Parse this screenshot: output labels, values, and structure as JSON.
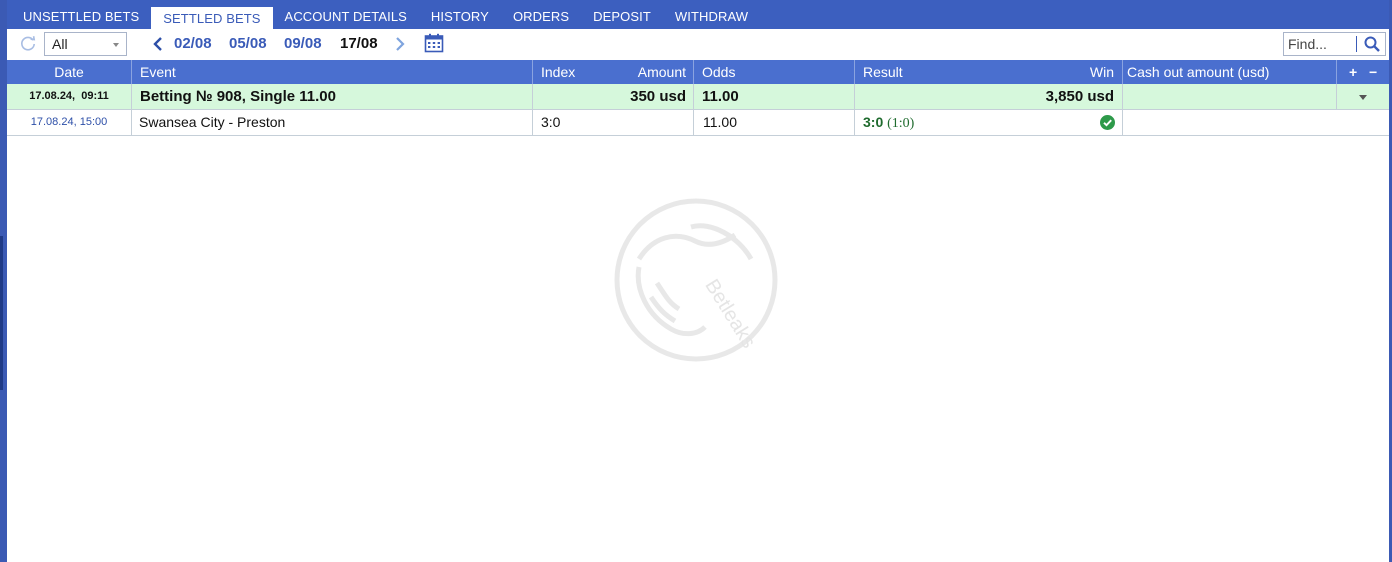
{
  "tabs": [
    {
      "label": "UNSETTLED BETS",
      "active": false
    },
    {
      "label": "SETTLED BETS",
      "active": true
    },
    {
      "label": "ACCOUNT DETAILS",
      "active": false
    },
    {
      "label": "HISTORY",
      "active": false
    },
    {
      "label": "ORDERS",
      "active": false
    },
    {
      "label": "DEPOSIT",
      "active": false
    },
    {
      "label": "WITHDRAW",
      "active": false
    }
  ],
  "toolbar": {
    "filter_value": "All",
    "dates": [
      "02/08",
      "05/08",
      "09/08",
      "17/08"
    ],
    "current_date": "17/08",
    "find_placeholder": "Find..."
  },
  "table": {
    "headers": {
      "date": "Date",
      "event": "Event",
      "index": "Index",
      "amount": "Amount",
      "odds": "Odds",
      "result": "Result",
      "win": "Win",
      "cashout": "Cash out amount (usd)",
      "plus": "+",
      "minus": "−"
    },
    "bet": {
      "date": "17.08.24,",
      "time": "09:11",
      "title": "Betting № 908, Single 11.00",
      "amount": "350 usd",
      "odds": "11.00",
      "win": "3,850 usd"
    },
    "event_row": {
      "date": "17.08.24,",
      "time": "15:00",
      "event": "Swansea City - Preston",
      "index": "3:0",
      "odds": "11.00",
      "score": "3:0",
      "half": "(1:0)"
    }
  },
  "watermark": "Betleaks",
  "colors": {
    "accent": "#4a6fcf",
    "bet_row_bg": "#d6f8dc",
    "win_check": "#2e9a4a",
    "link": "#3a5bb8"
  }
}
